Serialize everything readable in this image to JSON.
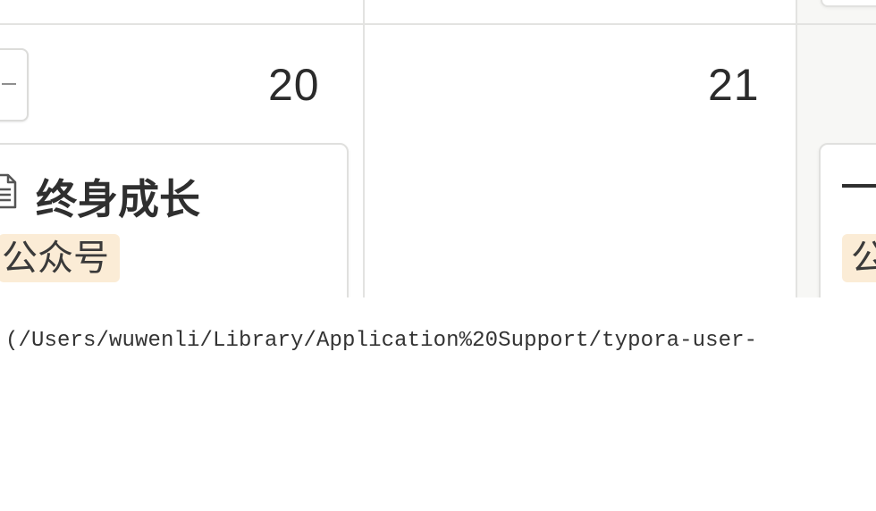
{
  "calendar": {
    "days": [
      {
        "number": "20"
      },
      {
        "number": "21"
      }
    ],
    "cards": [
      {
        "title": "终身成长",
        "icon": "document-icon",
        "tag": "公众号"
      },
      {
        "title": "一",
        "tag": "公"
      }
    ]
  },
  "image_path": {
    "text": "(/Users/wuwenli/Library/Application%20Support/typora-user-"
  },
  "colors": {
    "tag_bg": "#fbecd6",
    "grid_line": "#e3e3e1",
    "card_border": "#e0e0de",
    "text": "#2f2f2f"
  }
}
